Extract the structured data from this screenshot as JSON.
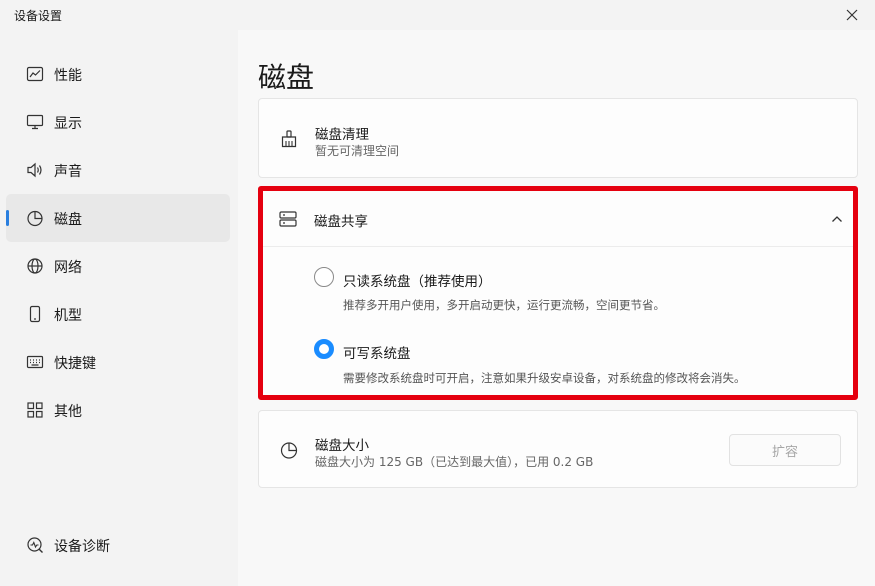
{
  "window": {
    "title": "设备设置",
    "close_icon": "close-icon"
  },
  "sidebar": {
    "accent": "#2a7fdf",
    "items": [
      {
        "label": "性能",
        "icon": "performance-chart-icon"
      },
      {
        "label": "显示",
        "icon": "monitor-icon"
      },
      {
        "label": "声音",
        "icon": "speaker-icon"
      },
      {
        "label": "磁盘",
        "icon": "pie-chart-icon",
        "active": true
      },
      {
        "label": "网络",
        "icon": "globe-icon"
      },
      {
        "label": "机型",
        "icon": "phone-icon"
      },
      {
        "label": "快捷键",
        "icon": "keyboard-icon"
      },
      {
        "label": "其他",
        "icon": "grid-icon"
      }
    ],
    "footer": {
      "label": "设备诊断",
      "icon": "diagnostics-icon"
    }
  },
  "main": {
    "title": "磁盘",
    "cleanup": {
      "title": "磁盘清理",
      "subtitle": "暂无可清理空间",
      "icon": "broom-icon"
    },
    "share": {
      "title": "磁盘共享",
      "icon": "server-icon",
      "expanded": true,
      "highlight_color": "#e5000f",
      "options": [
        {
          "label": "只读系统盘（推荐使用）",
          "desc": "推荐多开用户使用，多开启动更快，运行更流畅，空间更节省。",
          "checked": false
        },
        {
          "label": "可写系统盘",
          "desc": "需要修改系统盘时可开启，注意如果升级安卓设备，对系统盘的修改将会消失。",
          "checked": true
        }
      ]
    },
    "size": {
      "title": "磁盘大小",
      "subtitle": "磁盘大小为 125 GB（已达到最大值），已用 0.2 GB",
      "icon": "pie-chart-icon",
      "button": "扩容",
      "button_disabled": true
    }
  }
}
